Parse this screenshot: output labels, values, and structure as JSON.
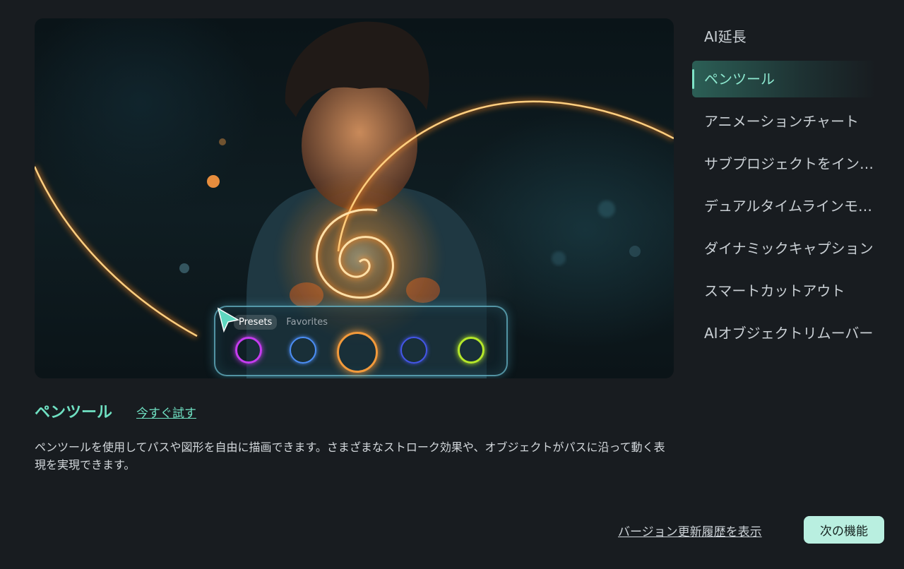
{
  "preview": {
    "picker": {
      "tabs": [
        "Presets",
        "Favorites"
      ],
      "swatch_colors": [
        "#c63cf0",
        "#4c8ef5",
        "#f39a3b",
        "#4456e8",
        "#b5e82a"
      ]
    }
  },
  "sidebar": {
    "items": [
      {
        "label": "AI延長"
      },
      {
        "label": "ペンツール",
        "active": true
      },
      {
        "label": "アニメーションチャート"
      },
      {
        "label": "サブプロジェクトをインポート"
      },
      {
        "label": "デュアルタイムラインモード"
      },
      {
        "label": "ダイナミックキャプション"
      },
      {
        "label": "スマートカットアウト"
      },
      {
        "label": "AIオブジェクトリムーバー"
      }
    ]
  },
  "detail": {
    "title": "ペンツール",
    "try_label": "今すぐ試す",
    "description": "ペンツールを使用してパスや図形を自由に描画できます。さまざまなストローク効果や、オブジェクトがパスに沿って動く表現を実現できます。"
  },
  "footer": {
    "history_label": "バージョン更新履歴を表示",
    "next_label": "次の機能"
  },
  "colors": {
    "accent": "#6fe0c2",
    "button_bg": "#b9efe0",
    "background": "#181c20"
  }
}
